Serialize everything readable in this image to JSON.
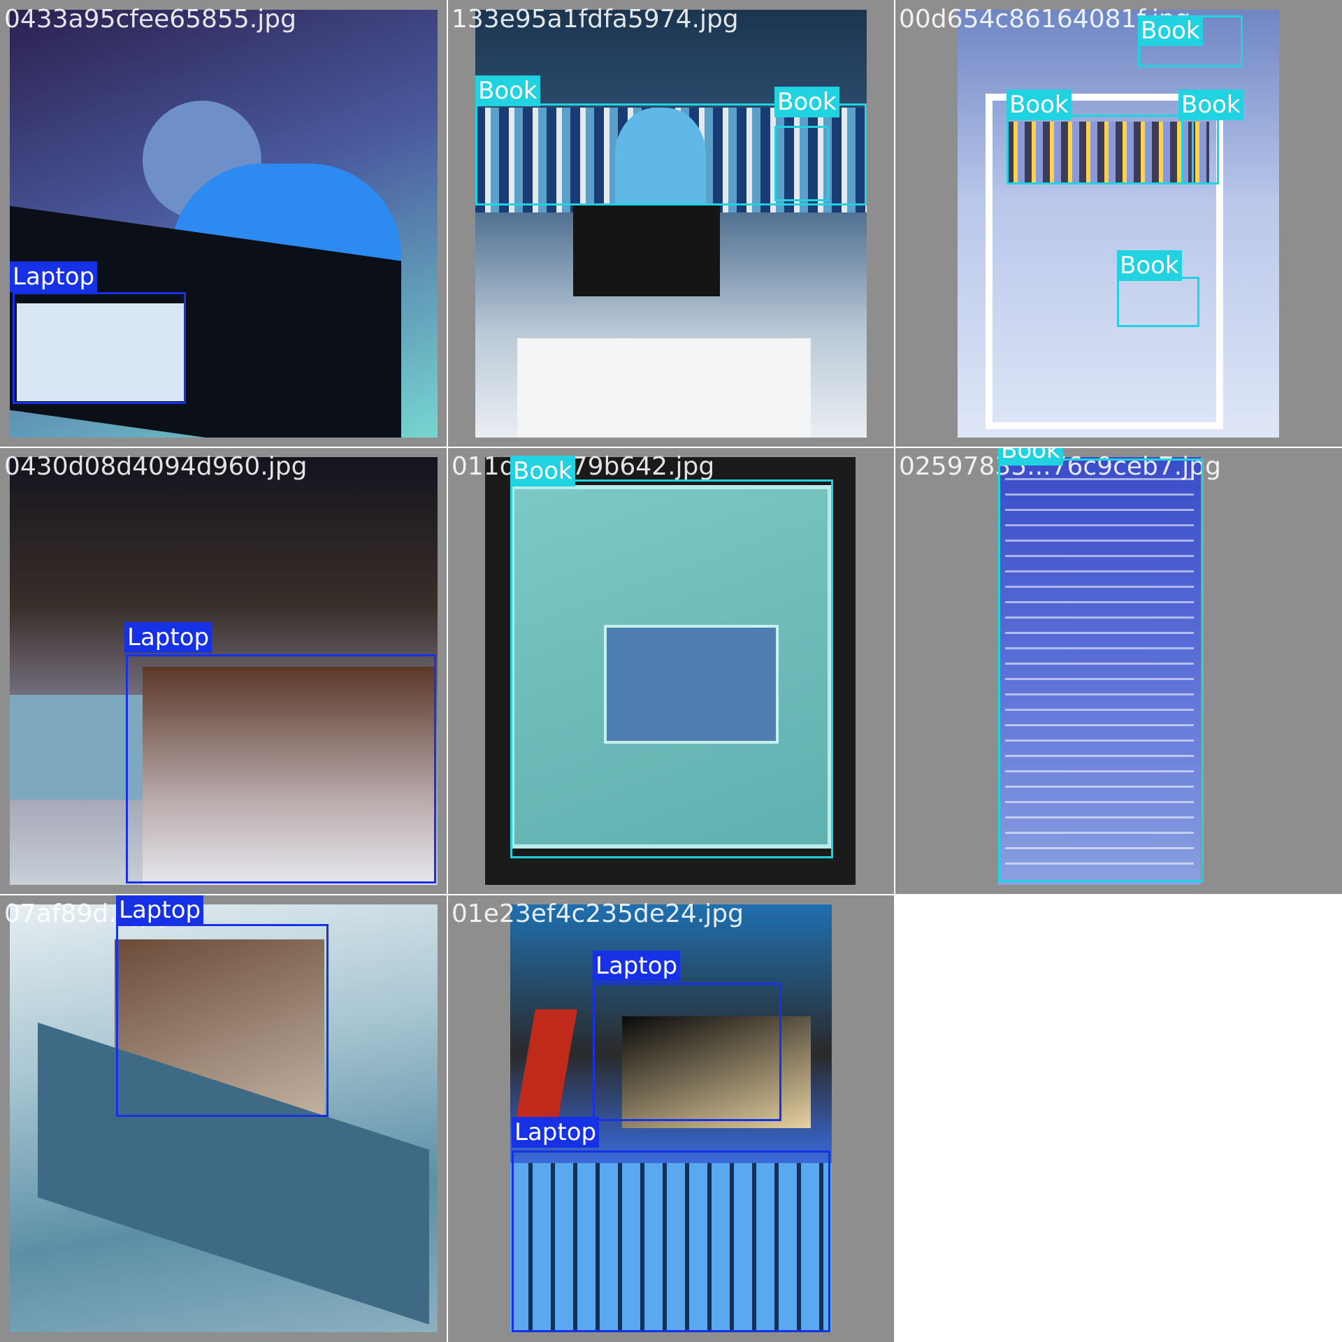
{
  "colors": {
    "laptop": "#1631e6",
    "book": "#21d2e0",
    "tile_bg": "#8e8e8e"
  },
  "tiles": [
    {
      "filename": "0433a95cfee65855.jpg",
      "labels": [
        "Laptop"
      ]
    },
    {
      "filename": "133e95a1fdfa5974.jpg",
      "labels": [
        "Book",
        "Book"
      ]
    },
    {
      "filename": "00d654c86164081f.jpg",
      "labels": [
        "Book",
        "Book",
        "Book",
        "Book"
      ]
    },
    {
      "filename": "0430d08d4094d960.jpg",
      "labels": [
        "Laptop"
      ]
    },
    {
      "filename": "011d...1079b642.jpg",
      "labels": [
        "Book"
      ]
    },
    {
      "filename": "02597835...76c9ceb7.jpg",
      "labels": [
        "Book"
      ]
    },
    {
      "filename": "07af89d...jpg",
      "labels": [
        "Laptop"
      ]
    },
    {
      "filename": "01e23ef4c235de24.jpg",
      "labels": [
        "Laptop",
        "Laptop"
      ]
    }
  ]
}
